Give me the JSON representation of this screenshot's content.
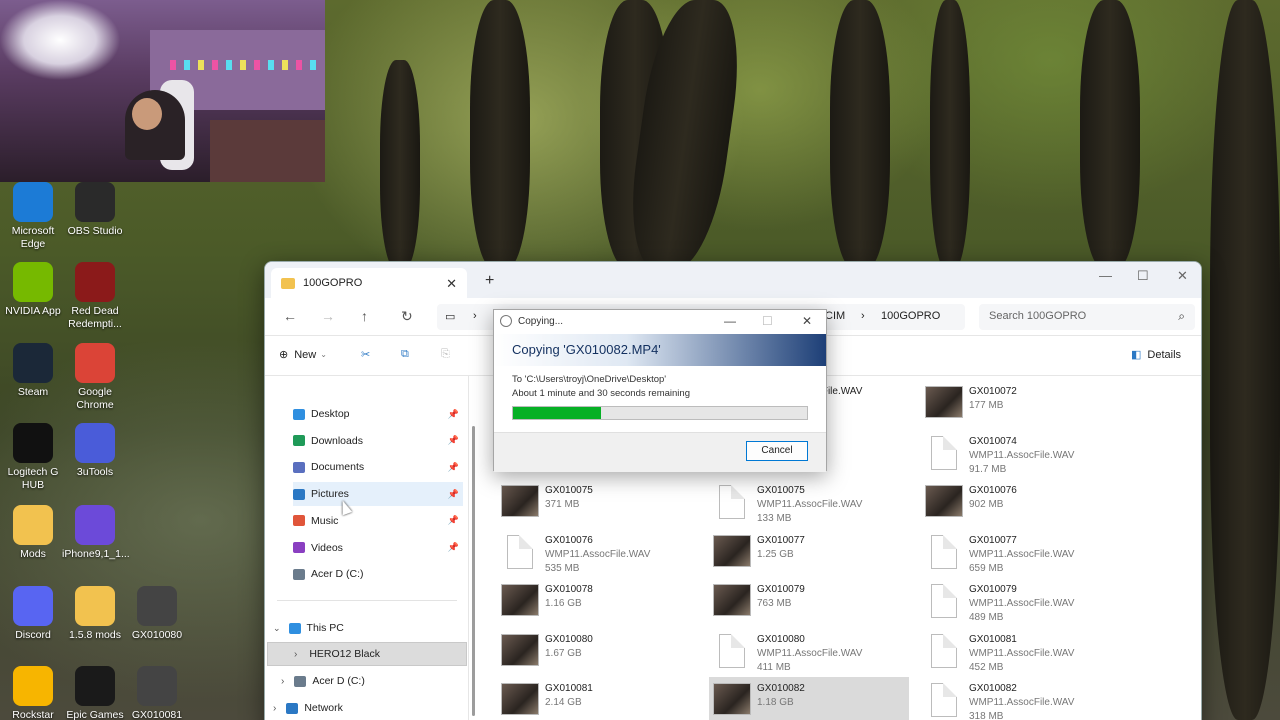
{
  "desktop": {
    "icons": [
      {
        "label": "Microsoft Edge",
        "icon": "edge-icon",
        "color": "#1c7bd6"
      },
      {
        "label": "OBS Studio",
        "icon": "obs-icon",
        "color": "#2a2a2a"
      },
      {
        "label": "NVIDIA App",
        "icon": "nvidia-icon",
        "color": "#76b900"
      },
      {
        "label": "Red Dead Redempti...",
        "icon": "rdr-icon",
        "color": "#8b1a1a"
      },
      {
        "label": "Steam",
        "icon": "steam-icon",
        "color": "#1b2838"
      },
      {
        "label": "Google Chrome",
        "icon": "chrome-icon",
        "color": "#db4437"
      },
      {
        "label": "Logitech G HUB",
        "icon": "logitech-icon",
        "color": "#111111"
      },
      {
        "label": "3uTools",
        "icon": "3utools-icon",
        "color": "#4a5cd9"
      },
      {
        "label": "Mods",
        "icon": "folder-icon",
        "color": "#f2c24f"
      },
      {
        "label": "iPhone9,1_1...",
        "icon": "3utools-file-icon",
        "color": "#6c4ad9"
      },
      {
        "label": "Discord",
        "icon": "discord-icon",
        "color": "#5865f2"
      },
      {
        "label": "1.5.8 mods",
        "icon": "folder-icon",
        "color": "#f2c24f"
      },
      {
        "label": "GX010080",
        "icon": "video-file-icon",
        "color": "#444444"
      },
      {
        "label": "Rockstar Games",
        "icon": "rockstar-icon",
        "color": "#f7b500"
      },
      {
        "label": "Epic Games Launcher",
        "icon": "epic-icon",
        "color": "#1a1a1a"
      },
      {
        "label": "GX010081",
        "icon": "video-file-icon",
        "color": "#444444"
      }
    ]
  },
  "explorer": {
    "tab_title": "100GOPRO",
    "breadcrumb_tail": [
      "CIM",
      "100GOPRO"
    ],
    "search_placeholder": "Search 100GOPRO",
    "new_label": "New",
    "details_label": "Details",
    "nav": {
      "quick": [
        {
          "label": "Desktop",
          "color": "#2f8fe0",
          "pinned": true
        },
        {
          "label": "Downloads",
          "color": "#1f9a58",
          "pinned": true
        },
        {
          "label": "Documents",
          "color": "#5a6fbf",
          "pinned": true
        },
        {
          "label": "Pictures",
          "color": "#2b78c4",
          "pinned": true
        },
        {
          "label": "Music",
          "color": "#e0553a",
          "pinned": true
        },
        {
          "label": "Videos",
          "color": "#8a3fc1",
          "pinned": true
        },
        {
          "label": "Acer D  (C:)",
          "color": "#6a7b8c",
          "pinned": false
        }
      ],
      "this_pc": "This PC",
      "hero": "HERO12 Black",
      "acer": "Acer D  (C:)",
      "network": "Network"
    },
    "files": [
      {
        "name": "GX010072",
        "type": "",
        "size": "177 MB",
        "kind": "video",
        "col": 2,
        "row": 0
      },
      {
        "name": "",
        "type": "WMP11.AssocFile.WAV",
        "size": "",
        "kind": "doc",
        "col": 1,
        "row": 0
      },
      {
        "name": "GX010074",
        "type": "WMP11.AssocFile.WAV",
        "size": "91.7 MB",
        "kind": "doc",
        "col": 2,
        "row": 1
      },
      {
        "name": "GX010075",
        "type": "",
        "size": "371 MB",
        "kind": "video",
        "col": 0,
        "row": 2
      },
      {
        "name": "GX010075",
        "type": "WMP11.AssocFile.WAV",
        "size": "133 MB",
        "kind": "doc",
        "col": 1,
        "row": 2
      },
      {
        "name": "GX010076",
        "type": "",
        "size": "902 MB",
        "kind": "video",
        "col": 2,
        "row": 2
      },
      {
        "name": "GX010076",
        "type": "WMP11.AssocFile.WAV",
        "size": "535 MB",
        "kind": "doc",
        "col": 0,
        "row": 3
      },
      {
        "name": "GX010077",
        "type": "",
        "size": "1.25 GB",
        "kind": "video",
        "col": 1,
        "row": 3
      },
      {
        "name": "GX010077",
        "type": "WMP11.AssocFile.WAV",
        "size": "659 MB",
        "kind": "doc",
        "col": 2,
        "row": 3
      },
      {
        "name": "GX010078",
        "type": "",
        "size": "1.16 GB",
        "kind": "video",
        "col": 0,
        "row": 4
      },
      {
        "name": "GX010079",
        "type": "",
        "size": "763 MB",
        "kind": "video",
        "col": 1,
        "row": 4
      },
      {
        "name": "GX010079",
        "type": "WMP11.AssocFile.WAV",
        "size": "489 MB",
        "kind": "doc",
        "col": 2,
        "row": 4
      },
      {
        "name": "GX010080",
        "type": "",
        "size": "1.67 GB",
        "kind": "video",
        "col": 0,
        "row": 5
      },
      {
        "name": "GX010080",
        "type": "WMP11.AssocFile.WAV",
        "size": "411 MB",
        "kind": "doc",
        "col": 1,
        "row": 5
      },
      {
        "name": "GX010081",
        "type": "WMP11.AssocFile.WAV",
        "size": "452 MB",
        "kind": "doc",
        "col": 2,
        "row": 5
      },
      {
        "name": "GX010081",
        "type": "",
        "size": "2.14 GB",
        "kind": "video",
        "col": 0,
        "row": 6
      },
      {
        "name": "GX010082",
        "type": "",
        "size": "1.18 GB",
        "kind": "video",
        "col": 1,
        "row": 6,
        "selected": true
      },
      {
        "name": "GX010082",
        "type": "WMP11.AssocFile.WAV",
        "size": "318 MB",
        "kind": "doc",
        "col": 2,
        "row": 6
      }
    ]
  },
  "copy_dialog": {
    "title": "Copying...",
    "heading": "Copying 'GX010082.MP4'",
    "destination": "To 'C:\\Users\\troyj\\OneDrive\\Desktop'",
    "remaining": "About 1 minute and 30 seconds remaining",
    "progress": 0.3,
    "cancel_label": "Cancel",
    "progress_color": "#06b025"
  }
}
